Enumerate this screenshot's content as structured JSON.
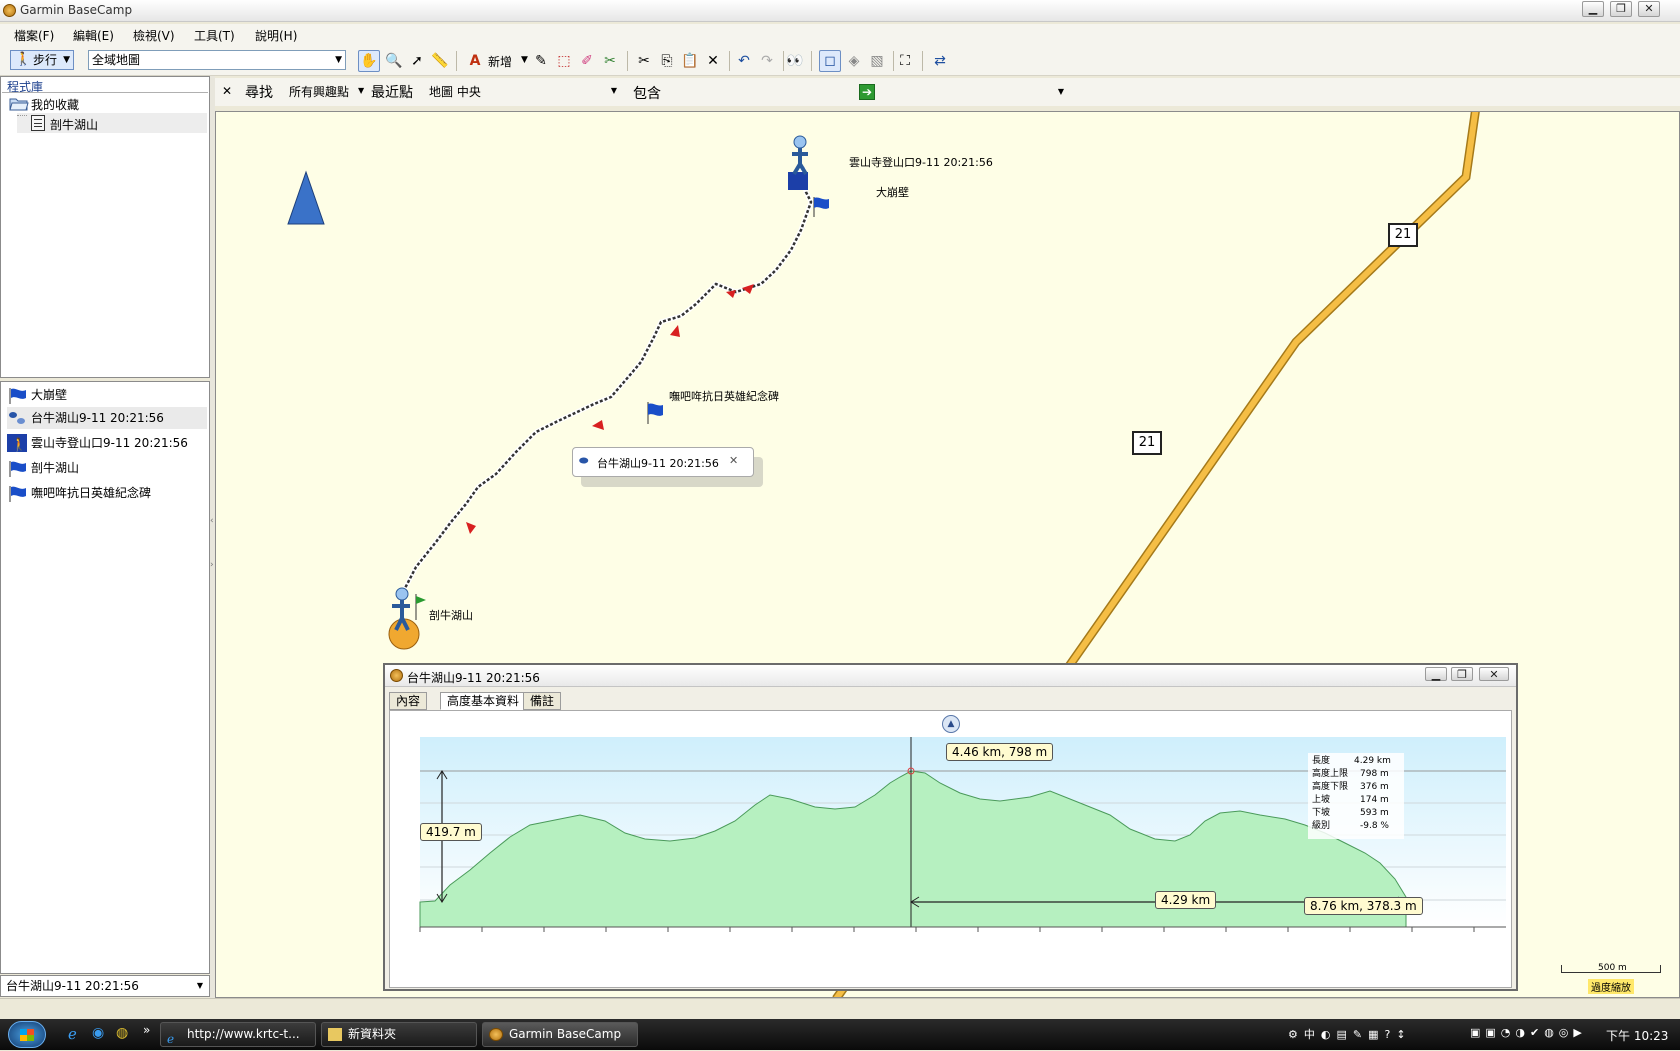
{
  "app": {
    "title": "Garmin BaseCamp"
  },
  "window_controls": {
    "minimize": "▁",
    "restore": "❐",
    "close": "✕"
  },
  "menu": [
    "檔案(F)",
    "編輯(E)",
    "檢視(V)",
    "工具(T)",
    "說明(H)"
  ],
  "toolbar": {
    "activity": "步行",
    "map_select": "全域地圖",
    "new_label": "新增"
  },
  "library": {
    "title": "程式庫",
    "folder": "我的收藏",
    "item": "剖牛湖山"
  },
  "list_items": [
    {
      "label": "大崩壁",
      "icon": "flag-icon"
    },
    {
      "label": "台牛湖山9-11 20:21:56",
      "icon": "track-icon"
    },
    {
      "label": "雲山寺登山口9-11 20:21:56",
      "icon": "hiker-icon"
    },
    {
      "label": "剖牛湖山",
      "icon": "flag-icon"
    },
    {
      "label": "嘸吧哖抗日英雄紀念碑",
      "icon": "flag-icon"
    }
  ],
  "left_bottom": {
    "selected": "台牛湖山9-11 20:21:56"
  },
  "findbar": {
    "close": "✕",
    "find": "尋找",
    "poi": "所有興趣點",
    "nearest": "最近點",
    "map_center": "地圖 中央",
    "contains": "包含"
  },
  "map": {
    "labels": {
      "start": "雲山寺登山口9-11 20:21:56",
      "wall": "大崩壁",
      "memorial": "嘸吧哖抗日英雄紀念碑",
      "end": "剖牛湖山",
      "road_a": "21",
      "road_b": "21"
    },
    "popup": "台牛湖山9-11 20:21:56",
    "scale": "500 m",
    "scale_note": "過度縮放"
  },
  "profile": {
    "title": "台牛湖山9-11 20:21:56",
    "tabs": [
      "內容",
      "高度基本資料",
      "備註"
    ],
    "callouts": {
      "peak": "4.46 km, 798 m",
      "gain": "419.7 m",
      "dist": "4.29 km",
      "end": "8.76 km, 378.3 m"
    },
    "axis_top": "800",
    "stats": [
      {
        "k": "長度",
        "v": "4.29 km"
      },
      {
        "k": "高度上限",
        "v": "798 m"
      },
      {
        "k": "高度下限",
        "v": "376 m"
      },
      {
        "k": "上坡",
        "v": "174 m"
      },
      {
        "k": "下坡",
        "v": "593 m"
      },
      {
        "k": "級別",
        "v": "-9.8 %"
      }
    ]
  },
  "taskbar": {
    "tasks": [
      "http://www.krtc-t...",
      "新資料夾",
      "Garmin BaseCamp"
    ],
    "tray": "中",
    "clock": "下午 10:23"
  },
  "colors": {
    "road": "#f5be45",
    "track": "#333333",
    "profile_fill": "#b6f0c0",
    "sky": "#cfeffc"
  }
}
